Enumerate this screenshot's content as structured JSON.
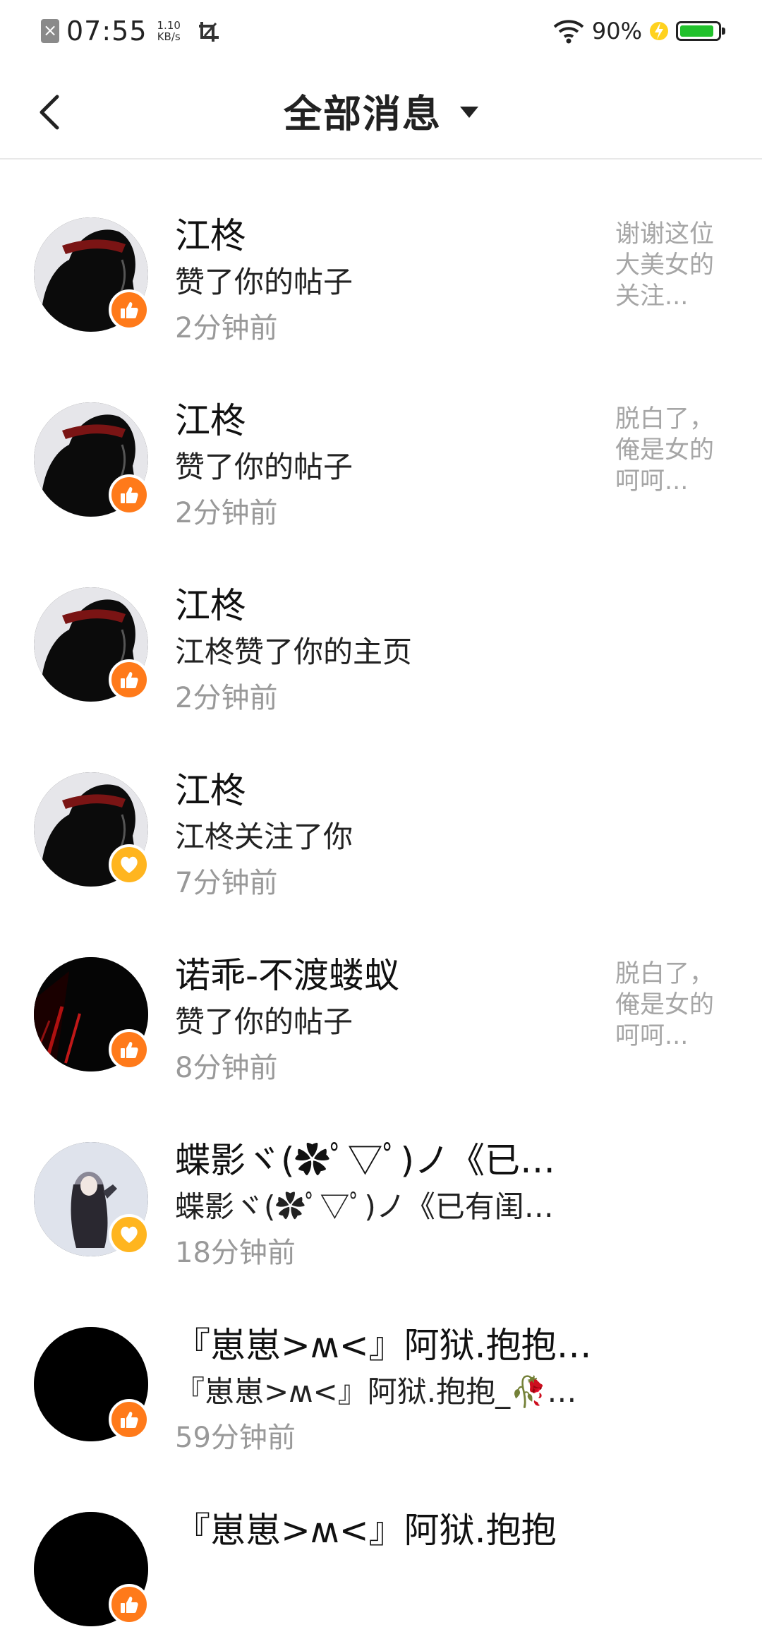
{
  "status_bar": {
    "time": "07:55",
    "net_speed_value": "1.10",
    "net_speed_unit": "KB/s",
    "battery_text": "90%",
    "battery_level": 0.9,
    "battery_color": "#21c12b"
  },
  "header": {
    "title": "全部消息",
    "back_icon": "chevron-left-icon",
    "dropdown_icon": "triangle-down-icon"
  },
  "colors": {
    "like_badge": "#ff7a1a",
    "follow_badge": "#ffb51f",
    "time_text": "#999999",
    "preview_text": "#a6a6a6"
  },
  "messages": [
    {
      "name": "江柊",
      "action": "赞了你的帖子",
      "time": "2分钟前",
      "preview": "谢谢这位\n大美女的\n关注...",
      "badge": "like",
      "avatar": "dark-silhouette"
    },
    {
      "name": "江柊",
      "action": "赞了你的帖子",
      "time": "2分钟前",
      "preview": "脱白了，\n俺是女的\n呵呵...",
      "badge": "like",
      "avatar": "dark-silhouette"
    },
    {
      "name": "江柊",
      "action": "江柊赞了你的主页",
      "time": "2分钟前",
      "preview": "",
      "badge": "like",
      "avatar": "dark-silhouette"
    },
    {
      "name": "江柊",
      "action": "江柊关注了你",
      "time": "7分钟前",
      "preview": "",
      "badge": "follow",
      "avatar": "dark-silhouette"
    },
    {
      "name": "诺乖-不渡蝼蚁",
      "action": "赞了你的帖子",
      "time": "8分钟前",
      "preview": "脱白了，\n俺是女的\n呵呵...",
      "badge": "like",
      "avatar": "dark-red"
    },
    {
      "name": "蝶影ヾ(✿ﾟ▽ﾟ)ノ《已…",
      "action": "蝶影ヾ(✿ﾟ▽ﾟ)ノ《已有闺…",
      "time": "18分钟前",
      "preview": "",
      "badge": "follow",
      "avatar": "light-figure"
    },
    {
      "name": "『崽崽>ʍ<』阿狱.抱抱…",
      "action": "『崽崽>ʍ<』阿狱.抱抱_🥀…",
      "time": "59分钟前",
      "preview": "",
      "badge": "like",
      "avatar": "solid-black"
    },
    {
      "name": "『崽崽>ʍ<』阿狱.抱抱",
      "action": "",
      "time": "",
      "preview": "",
      "badge": "like",
      "avatar": "solid-black"
    }
  ]
}
